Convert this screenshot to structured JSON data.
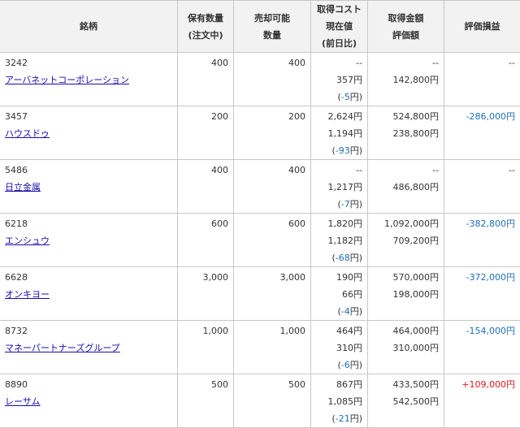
{
  "headers": {
    "name": "銘柄",
    "qty_l1": "保有数量",
    "qty_l2": "(注文中)",
    "sell_l1": "売却可能",
    "sell_l2": "数量",
    "price_l1": "取得コスト",
    "price_l2": "現在値",
    "price_l3": "(前日比)",
    "amt_l1": "取得金額",
    "amt_l2": "評価額",
    "pl": "評価損益"
  },
  "rows": [
    {
      "code": "3242",
      "name": "アーバネットコーポレーション",
      "qty": "400",
      "sellable": "400",
      "cost": "--",
      "current": "357円",
      "change": "-5",
      "cost_amount": "--",
      "valuation": "142,800円",
      "pl": "--",
      "pl_color": "default"
    },
    {
      "code": "3457",
      "name": "ハウスドゥ",
      "qty": "200",
      "sellable": "200",
      "cost": "2,624円",
      "current": "1,194円",
      "change": "-93",
      "cost_amount": "524,800円",
      "valuation": "238,800円",
      "pl": "-286,000円",
      "pl_color": "blue"
    },
    {
      "code": "5486",
      "name": "日立金属",
      "qty": "400",
      "sellable": "400",
      "cost": "--",
      "current": "1,217円",
      "change": "-7",
      "cost_amount": "--",
      "valuation": "486,800円",
      "pl": "--",
      "pl_color": "default"
    },
    {
      "code": "6218",
      "name": "エンシュウ",
      "qty": "600",
      "sellable": "600",
      "cost": "1,820円",
      "current": "1,182円",
      "change": "-68",
      "cost_amount": "1,092,000円",
      "valuation": "709,200円",
      "pl": "-382,800円",
      "pl_color": "blue"
    },
    {
      "code": "6628",
      "name": "オンキヨー",
      "qty": "3,000",
      "sellable": "3,000",
      "cost": "190円",
      "current": "66円",
      "change": "-4",
      "cost_amount": "570,000円",
      "valuation": "198,000円",
      "pl": "-372,000円",
      "pl_color": "blue"
    },
    {
      "code": "8732",
      "name": "マネーパートナーズグループ",
      "qty": "1,000",
      "sellable": "1,000",
      "cost": "464円",
      "current": "310円",
      "change": "-6",
      "cost_amount": "464,000円",
      "valuation": "310,000円",
      "pl": "-154,000円",
      "pl_color": "blue"
    },
    {
      "code": "8890",
      "name": "レーサム",
      "qty": "500",
      "sellable": "500",
      "cost": "867円",
      "current": "1,085円",
      "change": "-21",
      "cost_amount": "433,500円",
      "valuation": "542,500円",
      "pl": "+109,000円",
      "pl_color": "red"
    }
  ],
  "labels": {
    "change_open": "(",
    "change_close": "円)"
  },
  "colors": {
    "link": "#1a0dab",
    "loss": "#1f6fb5",
    "gain": "#e0181e",
    "header_bg": "#f2f2f2",
    "border": "#c8c8c8"
  }
}
